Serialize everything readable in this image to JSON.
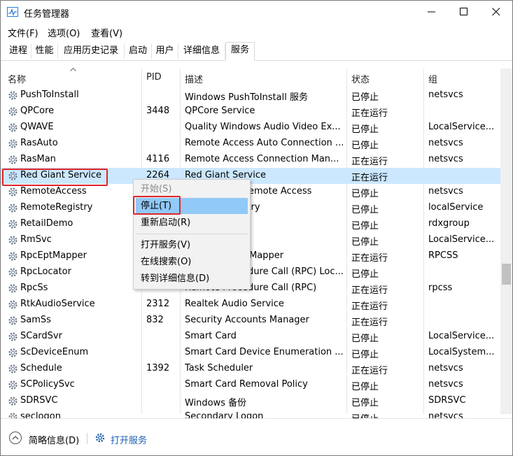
{
  "window": {
    "title": "任务管理器",
    "controls": {
      "minimize": "—",
      "maximize": "☐",
      "close": "✕"
    }
  },
  "menu": [
    "文件(F)",
    "选项(O)",
    "查看(V)"
  ],
  "tabs": [
    "进程",
    "性能",
    "应用历史记录",
    "启动",
    "用户",
    "详细信息",
    "服务"
  ],
  "active_tab": "服务",
  "columns": {
    "name": "名称",
    "pid": "PID",
    "desc": "描述",
    "status": "状态",
    "group": "组"
  },
  "rows": [
    {
      "name": "PushToInstall",
      "pid": "",
      "desc": "Windows PushToInstall 服务",
      "status": "已停止",
      "group": "netsvcs"
    },
    {
      "name": "QPCore",
      "pid": "3448",
      "desc": "QPCore Service",
      "status": "正在运行",
      "group": ""
    },
    {
      "name": "QWAVE",
      "pid": "",
      "desc": "Quality Windows Audio Video Ex...",
      "status": "已停止",
      "group": "LocalService..."
    },
    {
      "name": "RasAuto",
      "pid": "",
      "desc": "Remote Access Auto Connection ...",
      "status": "已停止",
      "group": "netsvcs"
    },
    {
      "name": "RasMan",
      "pid": "4116",
      "desc": "Remote Access Connection Man...",
      "status": "正在运行",
      "group": "netsvcs"
    },
    {
      "name": "Red Giant Service",
      "pid": "2264",
      "desc": "Red Giant Service",
      "status": "正在运行",
      "group": ""
    },
    {
      "name": "RemoteAccess",
      "pid": "",
      "desc": "Routing and Remote Access",
      "status": "已停止",
      "group": "netsvcs"
    },
    {
      "name": "RemoteRegistry",
      "pid": "",
      "desc": "Remote Registry",
      "status": "已停止",
      "group": "localService"
    },
    {
      "name": "RetailDemo",
      "pid": "",
      "desc": "",
      "status": "已停止",
      "group": "rdxgroup"
    },
    {
      "name": "RmSvc",
      "pid": "",
      "desc": "",
      "status": "已停止",
      "group": "LocalService..."
    },
    {
      "name": "RpcEptMapper",
      "pid": "",
      "desc": "RPC Endpoint Mapper",
      "status": "正在运行",
      "group": "RPCSS"
    },
    {
      "name": "RpcLocator",
      "pid": "",
      "desc": "Remote Procedure Call (RPC) Loc...",
      "status": "已停止",
      "group": ""
    },
    {
      "name": "RpcSs",
      "pid": "",
      "desc": "Remote Procedure Call (RPC)",
      "status": "正在运行",
      "group": "rpcss"
    },
    {
      "name": "RtkAudioService",
      "pid": "2312",
      "desc": "Realtek Audio Service",
      "status": "正在运行",
      "group": ""
    },
    {
      "name": "SamSs",
      "pid": "832",
      "desc": "Security Accounts Manager",
      "status": "正在运行",
      "group": ""
    },
    {
      "name": "SCardSvr",
      "pid": "",
      "desc": "Smart Card",
      "status": "已停止",
      "group": "LocalService..."
    },
    {
      "name": "ScDeviceEnum",
      "pid": "",
      "desc": "Smart Card Device Enumeration ...",
      "status": "已停止",
      "group": "LocalSystem..."
    },
    {
      "name": "Schedule",
      "pid": "1392",
      "desc": "Task Scheduler",
      "status": "正在运行",
      "group": "netsvcs"
    },
    {
      "name": "SCPolicySvc",
      "pid": "",
      "desc": "Smart Card Removal Policy",
      "status": "已停止",
      "group": "netsvcs"
    },
    {
      "name": "SDRSVC",
      "pid": "",
      "desc": "Windows 备份",
      "status": "已停止",
      "group": "SDRSVC"
    },
    {
      "name": "seclogon",
      "pid": "",
      "desc": "Secondary Logon",
      "status": "已停止",
      "group": "netsvcs"
    }
  ],
  "context_menu": [
    {
      "label": "开始(S)",
      "disabled": true
    },
    {
      "label": "停止(T)",
      "hover": true
    },
    {
      "label": "重新启动(R)"
    },
    {
      "separator": true
    },
    {
      "label": "打开服务(V)"
    },
    {
      "label": "在线搜索(O)"
    },
    {
      "label": "转到详细信息(D)"
    }
  ],
  "footer": {
    "less_details": "简略信息(D)",
    "open_services": "打开服务"
  },
  "colors": {
    "selected_row": "#cce8ff",
    "menu_hover": "#91c9f7",
    "annotation_red": "#e0262a",
    "link_blue": "#1a5fb4"
  }
}
